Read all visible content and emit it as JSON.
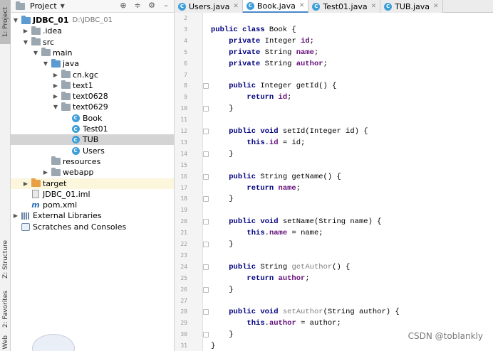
{
  "left_strip": {
    "project_tab": "1: Project",
    "structure_tab": "Z: Structure",
    "favorites_tab": "2: Favorites",
    "web_tab": "Web"
  },
  "project_panel": {
    "title": "Project",
    "tree": [
      {
        "label": "JDBC_01",
        "path": "D:\\JDBC_01",
        "depth": 0,
        "arrow": "down",
        "icon": "module-folder-icon",
        "bold": true
      },
      {
        "label": ".idea",
        "depth": 1,
        "arrow": "right",
        "icon": "folder-icon"
      },
      {
        "label": "src",
        "depth": 1,
        "arrow": "down",
        "icon": "folder-icon"
      },
      {
        "label": "main",
        "depth": 2,
        "arrow": "down",
        "icon": "folder-icon"
      },
      {
        "label": "java",
        "depth": 3,
        "arrow": "down",
        "icon": "source-folder-icon"
      },
      {
        "label": "cn.kgc",
        "depth": 4,
        "arrow": "right",
        "icon": "package-icon"
      },
      {
        "label": "text1",
        "depth": 4,
        "arrow": "right",
        "icon": "package-icon"
      },
      {
        "label": "text0628",
        "depth": 4,
        "arrow": "right",
        "icon": "package-icon"
      },
      {
        "label": "text0629",
        "depth": 4,
        "arrow": "down",
        "icon": "package-icon"
      },
      {
        "label": "Book",
        "depth": 5,
        "arrow": "",
        "icon": "class-icon"
      },
      {
        "label": "Test01",
        "depth": 5,
        "arrow": "",
        "icon": "class-icon"
      },
      {
        "label": "TUB",
        "depth": 5,
        "arrow": "",
        "icon": "class-icon",
        "selected": true
      },
      {
        "label": "Users",
        "depth": 5,
        "arrow": "",
        "icon": "class-icon"
      },
      {
        "label": "resources",
        "depth": 3,
        "arrow": "",
        "icon": "resources-folder-icon"
      },
      {
        "label": "webapp",
        "depth": 3,
        "arrow": "right",
        "icon": "folder-icon"
      },
      {
        "label": "target",
        "depth": 1,
        "arrow": "right",
        "icon": "excluded-folder-icon",
        "highlight": true
      },
      {
        "label": "JDBC_01.iml",
        "depth": 1,
        "arrow": "",
        "icon": "iml-file-icon"
      },
      {
        "label": "pom.xml",
        "depth": 1,
        "arrow": "",
        "icon": "maven-icon"
      },
      {
        "label": "External Libraries",
        "depth": 0,
        "arrow": "right",
        "icon": "library-icon"
      },
      {
        "label": "Scratches and Consoles",
        "depth": 0,
        "arrow": "",
        "icon": "scratch-icon"
      }
    ]
  },
  "tabs": [
    {
      "label": "Users.java",
      "active": false
    },
    {
      "label": "Book.java",
      "active": true
    },
    {
      "label": "Test01.java",
      "active": false
    },
    {
      "label": "TUB.java",
      "active": false
    }
  ],
  "editor": {
    "first_line": 2,
    "lines": [
      [],
      [
        [
          "kw",
          "public class "
        ],
        [
          "t",
          "Book {"
        ]
      ],
      [
        [
          "t",
          "    "
        ],
        [
          "kw",
          "private "
        ],
        [
          "t",
          "Integer "
        ],
        [
          "fld",
          "id"
        ],
        [
          "t",
          ";"
        ]
      ],
      [
        [
          "t",
          "    "
        ],
        [
          "kw",
          "private "
        ],
        [
          "t",
          "String "
        ],
        [
          "fld",
          "name"
        ],
        [
          "t",
          ";"
        ]
      ],
      [
        [
          "t",
          "    "
        ],
        [
          "kw",
          "private "
        ],
        [
          "t",
          "String "
        ],
        [
          "fld",
          "author"
        ],
        [
          "t",
          ";"
        ]
      ],
      [],
      [
        [
          "t",
          "    "
        ],
        [
          "kw",
          "public "
        ],
        [
          "t",
          "Integer getId() {"
        ]
      ],
      [
        [
          "t",
          "        "
        ],
        [
          "kw",
          "return "
        ],
        [
          "fld",
          "id"
        ],
        [
          "t",
          ";"
        ]
      ],
      [
        [
          "t",
          "    }"
        ]
      ],
      [],
      [
        [
          "t",
          "    "
        ],
        [
          "kw",
          "public void "
        ],
        [
          "t",
          "setId(Integer id) {"
        ]
      ],
      [
        [
          "t",
          "        "
        ],
        [
          "kw",
          "this"
        ],
        [
          "t",
          "."
        ],
        [
          "fld",
          "id"
        ],
        [
          "t",
          " = id;"
        ]
      ],
      [
        [
          "t",
          "    }"
        ]
      ],
      [],
      [
        [
          "t",
          "    "
        ],
        [
          "kw",
          "public "
        ],
        [
          "t",
          "String getName() {"
        ]
      ],
      [
        [
          "t",
          "        "
        ],
        [
          "kw",
          "return "
        ],
        [
          "fld",
          "name"
        ],
        [
          "t",
          ";"
        ]
      ],
      [
        [
          "t",
          "    }"
        ]
      ],
      [],
      [
        [
          "t",
          "    "
        ],
        [
          "kw",
          "public void "
        ],
        [
          "t",
          "setName(String name) {"
        ]
      ],
      [
        [
          "t",
          "        "
        ],
        [
          "kw",
          "this"
        ],
        [
          "t",
          "."
        ],
        [
          "fld",
          "name"
        ],
        [
          "t",
          " = name;"
        ]
      ],
      [
        [
          "t",
          "    }"
        ]
      ],
      [],
      [
        [
          "t",
          "    "
        ],
        [
          "kw",
          "public "
        ],
        [
          "t",
          "String "
        ],
        [
          "unused",
          "getAuthor"
        ],
        [
          "t",
          "() {"
        ]
      ],
      [
        [
          "t",
          "        "
        ],
        [
          "kw",
          "return "
        ],
        [
          "fld",
          "author"
        ],
        [
          "t",
          ";"
        ]
      ],
      [
        [
          "t",
          "    }"
        ]
      ],
      [],
      [
        [
          "t",
          "    "
        ],
        [
          "kw",
          "public void "
        ],
        [
          "unused",
          "setAuthor"
        ],
        [
          "t",
          "(String author) {"
        ]
      ],
      [
        [
          "t",
          "        "
        ],
        [
          "kw",
          "this"
        ],
        [
          "t",
          "."
        ],
        [
          "fld",
          "author"
        ],
        [
          "t",
          " = author;"
        ]
      ],
      [
        [
          "t",
          "    }"
        ]
      ],
      [
        [
          "t",
          "}"
        ]
      ]
    ]
  },
  "watermark": "CSDN @toblankly",
  "colors": {
    "keyword": "#000080",
    "field": "#660e7a",
    "selection": "#d4d4d4",
    "class_icon": "#3d9ed8"
  }
}
